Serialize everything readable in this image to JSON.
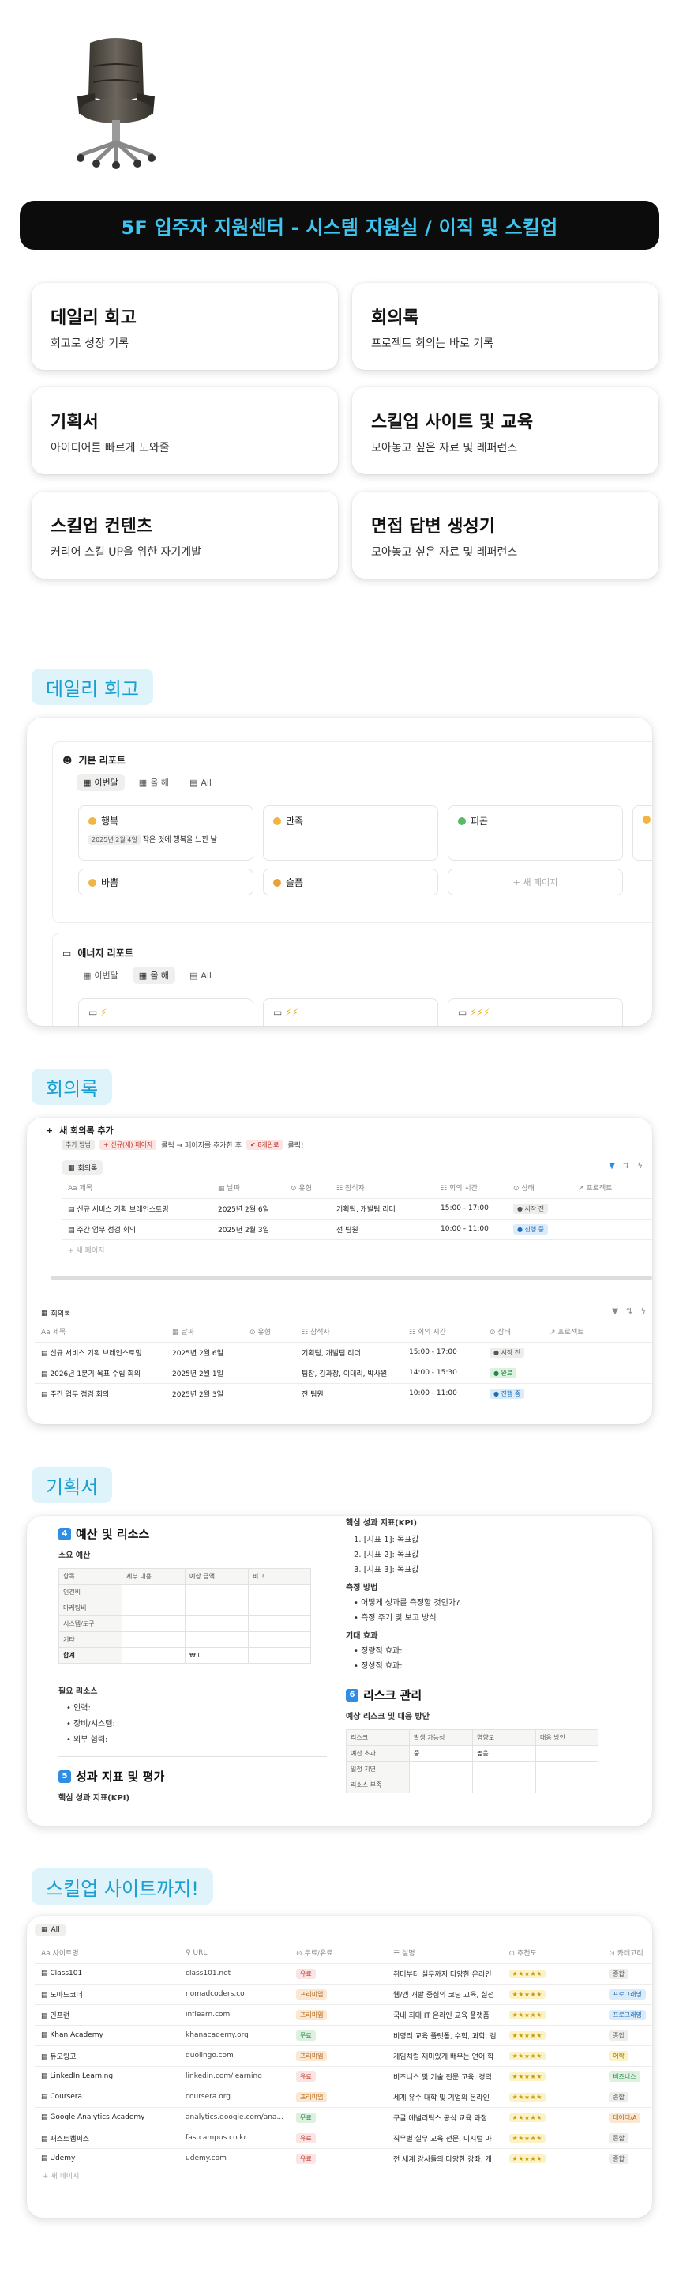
{
  "banner": {
    "title": "5F 입주자 지원센터 - 시스템 지원실 / 이직 및 스킬업"
  },
  "cards": [
    {
      "title": "데일리 회고",
      "subtitle": "회고로 성장 기록"
    },
    {
      "title": "회의록",
      "subtitle": "프로젝트 회의는 바로 기록"
    },
    {
      "title": "기획서",
      "subtitle": "아이디어를 빠르게 도와줄"
    },
    {
      "title": "스킬업 사이트 및 교육",
      "subtitle": "모아놓고 싶은 자료 및 레퍼런스"
    },
    {
      "title": "스킬업 컨텐츠",
      "subtitle": "커리어 스킬 UP을 위한 자기계발"
    },
    {
      "title": "면접 답변 생성기",
      "subtitle": "모아놓고 싶은 자료 및 레퍼런스"
    }
  ],
  "sections": {
    "daily": "데일리 회고",
    "minutes": "회의록",
    "plan": "기획서",
    "skill": "스킬업 사이트까지!"
  },
  "daily": {
    "basic": {
      "title": "기본 리포트",
      "tabs": [
        "이번달",
        "올 해",
        "All"
      ],
      "cards": [
        {
          "label": "행복",
          "color": "#f2b544",
          "date": "2025년 2월 4일",
          "note": "작은 것에 행복을 느낀 날"
        },
        {
          "label": "만족",
          "color": "#f2b544"
        },
        {
          "label": "피곤",
          "color": "#58b96a"
        },
        {
          "label": "바쁨",
          "color": "#f2b544"
        },
        {
          "label": "슬픔",
          "color": "#e9a23b"
        }
      ],
      "new_page": "+ 새 페이지"
    },
    "energy": {
      "title": "에너지 리포트",
      "tabs": [
        "이번달",
        "올 해",
        "All"
      ],
      "cards": [
        "⚡",
        "⚡⚡",
        "⚡⚡⚡"
      ]
    }
  },
  "minutes": {
    "add_title": "새 회의록 추가",
    "hint_prefix": "추가 방법",
    "hint_tag1": "+ 신규(새) 페이지",
    "hint_mid": "클릭 → 페이지를 추가한 후",
    "hint_tag2": "✔ 8개완료",
    "hint_end": "클릭!",
    "view_label": "회의록",
    "headers": [
      "제목",
      "날짜",
      "유형",
      "참석자",
      "회의 시간",
      "상태",
      "프로젝트"
    ],
    "top_rows": [
      {
        "title": "신규 서비스 기획 브레인스토밍",
        "date": "2025년 2월 6일",
        "people": "기획팀, 개발팀 리더",
        "time": "15:00 - 17:00",
        "status": "시작 전"
      },
      {
        "title": "주간 업무 점검 회의",
        "date": "2025년 2월 3일",
        "people": "전 팀원",
        "time": "10:00 - 11:00",
        "status": "진행 중"
      }
    ],
    "new_row": "+ 새 페이지",
    "bottom_rows": [
      {
        "title": "신규 서비스 기획 브레인스토밍",
        "date": "2025년 2월 6일",
        "people": "기획팀, 개발팀 리더",
        "time": "15:00 - 17:00",
        "status": "시작 전"
      },
      {
        "title": "2026년 1분기 목표 수립 회의",
        "date": "2025년 2월 1일",
        "people": "팀장, 김과장, 이대리, 박사원",
        "time": "14:00 - 15:30",
        "status": "완료"
      },
      {
        "title": "주간 업무 점검 회의",
        "date": "2025년 2월 3일",
        "people": "전 팀원",
        "time": "10:00 - 11:00",
        "status": "진행 중"
      }
    ]
  },
  "plan": {
    "budget_title": "예산 및 리소스",
    "budget_num": "4",
    "budget_sub": "소요 예산",
    "budget_headers": [
      "항목",
      "세부 내용",
      "예상 금액",
      "비고"
    ],
    "budget_rows": [
      "인건비",
      "마케팅비",
      "시스템/도구",
      "기타"
    ],
    "budget_total": "합계",
    "budget_total_value": "₩ 0",
    "resource_title": "필요 리소스",
    "resources": [
      "인력:",
      "장비/시스템:",
      "외부 협력:"
    ],
    "kpi_num": "5",
    "kpi_title": "성과 지표 및 평가",
    "kpi_sub": "핵심 성과 지표(KPI)",
    "kpi_list_title": "핵심 성과 지표(KPI)",
    "kpi_list": [
      "[지표 1]: 목표값",
      "[지표 2]: 목표값",
      "[지표 3]: 목표값"
    ],
    "measure_title": "측정 방법",
    "measures": [
      "어떻게 성과를 측정할 것인가?",
      "측정 주기 및 보고 방식"
    ],
    "effect_title": "기대 효과",
    "effects": [
      "정량적 효과:",
      "정성적 효과:"
    ],
    "risk_num": "6",
    "risk_title": "리스크 관리",
    "risk_sub": "예상 리스크 및 대응 방안",
    "risk_headers": [
      "리스크",
      "발생 가능성",
      "영향도",
      "대응 방안"
    ],
    "risk_rows": [
      {
        "name": "예산 초과",
        "prob": "중",
        "impact": "높음"
      },
      {
        "name": "일정 지연",
        "prob": "",
        "impact": ""
      },
      {
        "name": "리소스 부족",
        "prob": "",
        "impact": ""
      }
    ]
  },
  "skill": {
    "view_label": "All",
    "headers": [
      "사이트명",
      "URL",
      "무료/유료",
      "설명",
      "추천도",
      "카테고리"
    ],
    "rows": [
      {
        "name": "Class101",
        "url": "class101.net",
        "price": "유료",
        "desc": "취미부터 실무까지 다양한 온라인",
        "cat": "종합"
      },
      {
        "name": "노마드코더",
        "url": "nomadcoders.co",
        "price": "프리미엄",
        "desc": "웹/앱 개발 중심의 코딩 교육, 실전",
        "cat": "프로그래밍"
      },
      {
        "name": "인프런",
        "url": "inflearn.com",
        "price": "프리미엄",
        "desc": "국내 최대 IT 온라인 교육 플랫폼",
        "cat": "프로그래밍"
      },
      {
        "name": "Khan Academy",
        "url": "khanacademy.org",
        "price": "무료",
        "desc": "비영리 교육 플랫폼, 수학, 과학, 컴",
        "cat": "종합"
      },
      {
        "name": "듀오링고",
        "url": "duolingo.com",
        "price": "프리미엄",
        "desc": "게임처럼 재미있게 배우는 언어 학",
        "cat": "어학"
      },
      {
        "name": "LinkedIn Learning",
        "url": "linkedin.com/learning",
        "price": "유료",
        "desc": "비즈니스 및 기술 전문 교육, 경력",
        "cat": "비즈니스"
      },
      {
        "name": "Coursera",
        "url": "coursera.org",
        "price": "프리미엄",
        "desc": "세계 유수 대학 및 기업의 온라인",
        "cat": "종합"
      },
      {
        "name": "Google Analytics Academy",
        "url": "analytics.google.com/ana...",
        "price": "무료",
        "desc": "구글 애널리틱스 공식 교육 과정",
        "cat": "데이터/A"
      },
      {
        "name": "패스트캠퍼스",
        "url": "fastcampus.co.kr",
        "price": "유료",
        "desc": "직무별 실무 교육 전문, 디지털 마",
        "cat": "종합"
      },
      {
        "name": "Udemy",
        "url": "udemy.com",
        "price": "유료",
        "desc": "전 세계 강사들의 다양한 강좌, 개",
        "cat": "종합"
      }
    ],
    "new_row": "+ 새 페이지",
    "stars": "★★★★★"
  }
}
